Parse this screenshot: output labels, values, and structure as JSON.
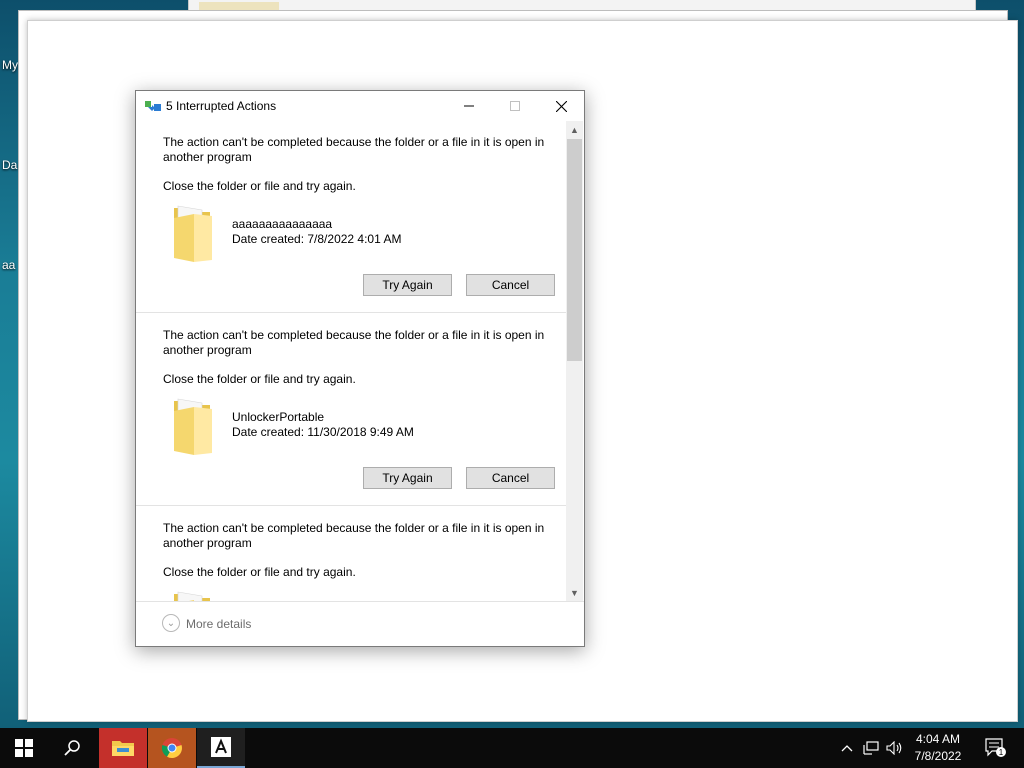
{
  "desktop": {
    "labels": [
      "My",
      "Da",
      "aa"
    ]
  },
  "dialog": {
    "title": "5 Interrupted Actions",
    "items": [
      {
        "message": "The action can't be completed because the folder or a file in it is open in another program",
        "instruction": "Close the folder or file and try again.",
        "name": "aaaaaaaaaaaaaaa",
        "date": "Date created: 7/8/2022 4:01 AM",
        "try_again": "Try Again",
        "cancel": "Cancel"
      },
      {
        "message": "The action can't be completed because the folder or a file in it is open in another program",
        "instruction": "Close the folder or file and try again.",
        "name": "UnlockerPortable",
        "date": "Date created: 11/30/2018 9:49 AM",
        "try_again": "Try Again",
        "cancel": "Cancel"
      },
      {
        "message": "The action can't be completed because the folder or a file in it is open in another program",
        "instruction": "Close the folder or file and try again."
      }
    ],
    "more_details": "More details"
  },
  "taskbar": {
    "clock_time": "4:04 AM",
    "clock_date": "7/8/2022",
    "notification_count": "1"
  }
}
